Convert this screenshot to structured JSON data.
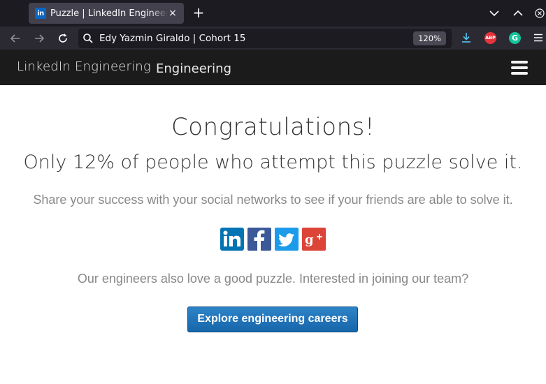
{
  "browser": {
    "tab": {
      "favicon_text": "in",
      "title": "Puzzle | LinkedIn Engineering",
      "close_glyph": "×"
    },
    "new_tab_glyph": "+",
    "address": "Edy Yazmin Giraldo | Cohort 15",
    "zoom": "120%",
    "extensions": {
      "abp_label": "ABP",
      "grammarly_label": "G"
    }
  },
  "site": {
    "brand": "LinkedIn Engineering",
    "brand_suffix": "Engineering"
  },
  "content": {
    "headline": "Congratulations!",
    "subhead": "Only 12% of people who attempt this puzzle solve it.",
    "share_text": "Share your success with your social networks to see if your friends are able to solve it.",
    "social_buttons": [
      {
        "name": "linkedin",
        "glyph": "in",
        "color": "#0274b3"
      },
      {
        "name": "facebook",
        "glyph": "f",
        "color": "#3b5998"
      },
      {
        "name": "twitter",
        "glyph": "twitter-bird",
        "color": "#1c9bea"
      },
      {
        "name": "google-plus",
        "glyph": "g+",
        "color": "#db4437"
      }
    ],
    "engineers_text": "Our engineers also love a good puzzle. Interested in joining our team?",
    "cta_label": "Explore engineering careers"
  },
  "colors": {
    "header_bg": "#1b1b1b",
    "cta_bg": "#1f73b7",
    "muted_text": "#888888"
  }
}
